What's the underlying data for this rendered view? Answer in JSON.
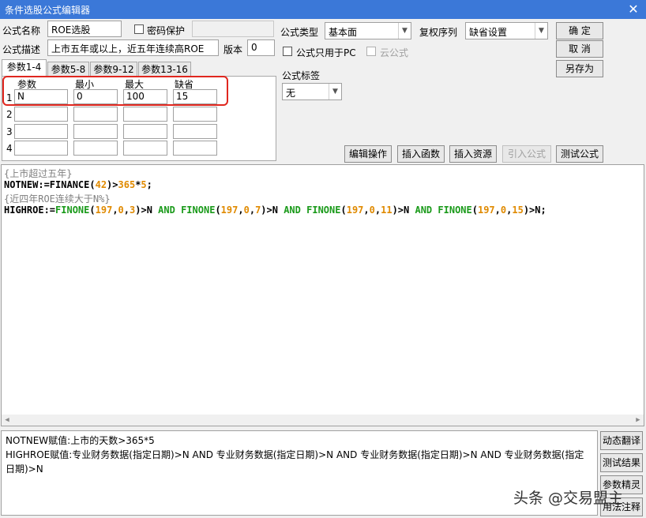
{
  "window": {
    "title": "条件选股公式编辑器",
    "close_glyph": "✕"
  },
  "form": {
    "name_label": "公式名称",
    "name_value": "ROE选股",
    "password_label": "密码保护",
    "password_value": "",
    "desc_label": "公式描述",
    "desc_value": "上市五年或以上，近五年连续高ROE",
    "version_label": "版本",
    "version_value": "0",
    "type_label": "公式类型",
    "type_value": "基本面",
    "rights_label": "复权序列",
    "rights_value": "缺省设置",
    "pc_only_label": "公式只用于PC",
    "cloud_label": "云公式",
    "tag_label": "公式标签",
    "tag_value": "无"
  },
  "buttons": {
    "ok": "确  定",
    "cancel": "取  消",
    "save_as": "另存为",
    "edit_op": "编辑操作",
    "insert_func": "插入函数",
    "insert_res": "插入资源",
    "import_formula": "引入公式",
    "test_formula": "测试公式"
  },
  "tabs": [
    "参数1-4",
    "参数5-8",
    "参数9-12",
    "参数13-16"
  ],
  "params": {
    "headers": [
      "参数",
      "最小",
      "最大",
      "缺省"
    ],
    "rows": [
      {
        "n": "1",
        "name": "N",
        "min": "0",
        "max": "100",
        "def": "15"
      },
      {
        "n": "2",
        "name": "",
        "min": "",
        "max": "",
        "def": ""
      },
      {
        "n": "3",
        "name": "",
        "min": "",
        "max": "",
        "def": ""
      },
      {
        "n": "4",
        "name": "",
        "min": "",
        "max": "",
        "def": ""
      }
    ]
  },
  "code": {
    "line1": "{上市超过五年}",
    "line3": "{近四年ROE连续大于N%}",
    "l2": {
      "a": "NOTNEW:=FINANCE(",
      "b": "42",
      "c": ")>",
      "d": "365",
      "e": "*",
      "f": "5",
      "g": ";"
    },
    "l4": {
      "a": "HIGHROE:=",
      "fn": "FINONE",
      "p1": "(",
      "n197": "197",
      "c": ",",
      "n0": "0",
      "n3": "3",
      "n7": "7",
      "n11": "11",
      "n15": "15",
      "gtN": ")>N ",
      "and": "AND",
      "sp": " ",
      "end": ")>N;"
    }
  },
  "description": {
    "line1": "NOTNEW赋值:上市的天数>365*5",
    "line2": "HIGHROE赋值:专业财务数据(指定日期)>N AND 专业财务数据(指定日期)>N AND 专业财务数据(指定日期)>N AND 专业财务数据(指定",
    "line3": "日期)>N"
  },
  "side_buttons": [
    "动态翻译",
    "测试结果",
    "参数精灵",
    "用法注释"
  ],
  "watermark": "头条 @交易盟主",
  "colors": {
    "titlebar": "#3b78d8",
    "highlight": "#e0271f",
    "function": "#1a9a1a",
    "number": "#e08a00",
    "comment": "#808080"
  }
}
